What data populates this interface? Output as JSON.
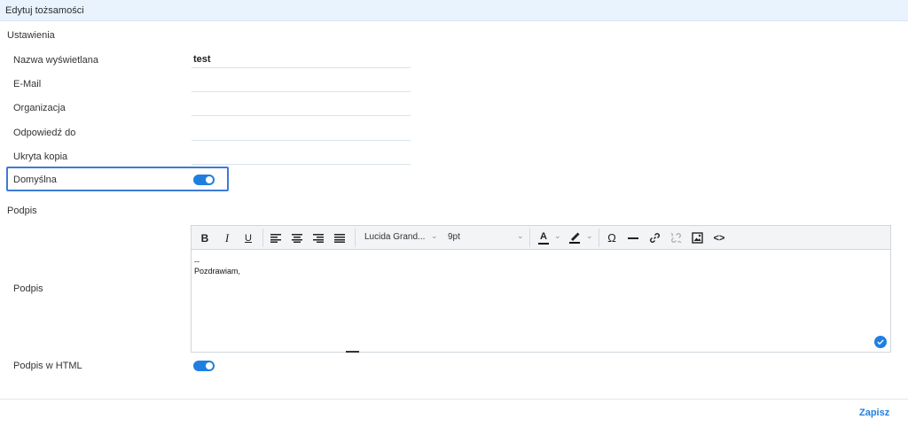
{
  "header": {
    "title": "Edytuj tożsamości"
  },
  "settings": {
    "section_label": "Ustawienia",
    "fields": {
      "display_name": {
        "label": "Nazwa wyświetlana",
        "value": "test"
      },
      "email": {
        "label": "E-Mail",
        "value": ""
      },
      "organization": {
        "label": "Organizacja",
        "value": ""
      },
      "reply_to": {
        "label": "Odpowiedź do",
        "value": ""
      },
      "bcc": {
        "label": "Ukryta kopia",
        "value": ""
      }
    },
    "default": {
      "label": "Domyślna",
      "enabled": true
    }
  },
  "signature": {
    "section_label": "Podpis",
    "label": "Podpis",
    "toolbar": {
      "bold": "B",
      "italic": "I",
      "underline": "U",
      "font_family": "Lucida Grand...",
      "font_size": "9pt",
      "text_color_glyph": "A",
      "special_char": "Ω",
      "html_source": "<>",
      "icons": [
        "bold-icon",
        "italic-icon",
        "underline-icon",
        "align-left-icon",
        "align-center-icon",
        "align-right-icon",
        "align-justify-icon",
        "chevron-down-icon",
        "text-color-icon",
        "highlight-icon",
        "omega-icon",
        "horizontal-rule-icon",
        "link-icon",
        "unlink-icon",
        "image-icon",
        "code-icon"
      ]
    },
    "content": {
      "line1": "--",
      "line2": "Pozdrawiam,"
    },
    "html": {
      "label": "Podpis w HTML",
      "enabled": true
    }
  },
  "footer": {
    "save_label": "Zapisz"
  },
  "colors": {
    "accent": "#1f7fe0",
    "header_bg": "#e8f3fd",
    "focus": "#3d7bd6"
  }
}
